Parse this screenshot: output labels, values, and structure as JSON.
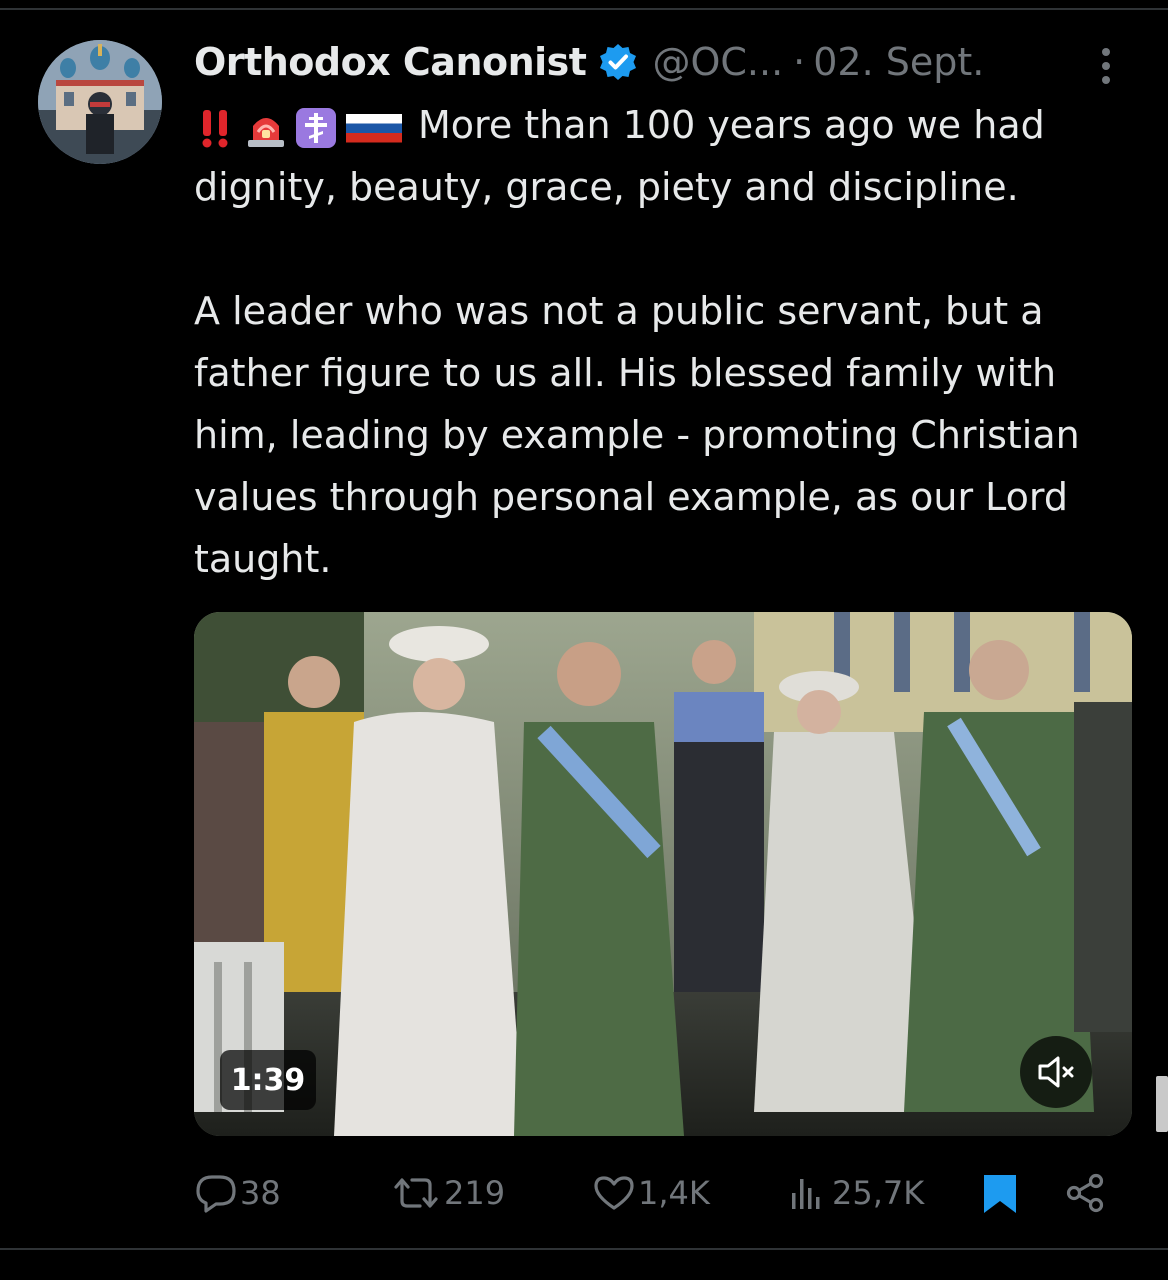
{
  "tweet": {
    "display_name": "Orthodox Canonist",
    "handle": "@OC...",
    "separator": "·",
    "date": "02. Sept.",
    "emojis": [
      "double-exclamation",
      "police-light",
      "orthodox-cross",
      "russia-flag"
    ],
    "line1": "More than 100 years ago we had",
    "line2": "dignity, beauty, grace, piety and discipline.",
    "paragraph2": "A leader who was not a public servant, but a father figure to us all. His blessed family with him, leading by example - promoting Christian values through personal example, as our Lord taught."
  },
  "media": {
    "duration": "1:39",
    "type": "video"
  },
  "actions": {
    "replies": "38",
    "retweets": "219",
    "likes": "1,4K",
    "views": "25,7K"
  },
  "colors": {
    "background": "#000000",
    "text": "#e7e9ea",
    "secondary": "#71767b",
    "verified": "#1d9bf0",
    "bookmark": "#1d9bf0",
    "divider": "#2f3336"
  },
  "icons": {
    "verified": "verified-badge-icon",
    "more": "more-vertical-icon",
    "reply": "reply-icon",
    "retweet": "retweet-icon",
    "like": "heart-icon",
    "views": "views-chart-icon",
    "bookmark": "bookmark-icon",
    "share": "share-icon",
    "mute": "speaker-muted-icon"
  }
}
